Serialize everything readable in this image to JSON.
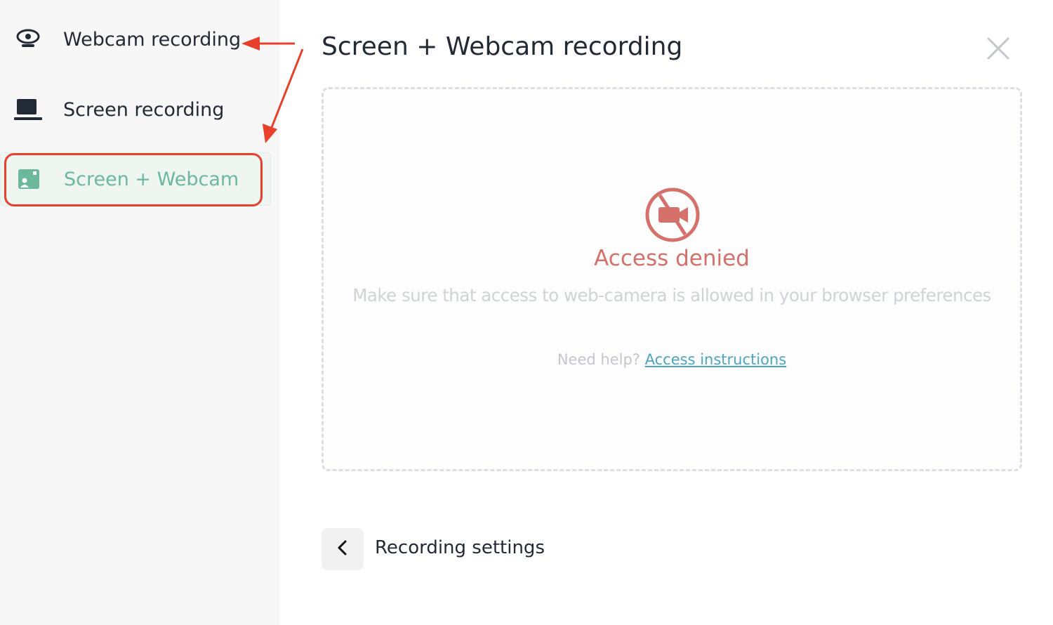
{
  "sidebar": {
    "items": [
      {
        "label": "Webcam recording",
        "icon": "webcam-icon",
        "active": false
      },
      {
        "label": "Screen recording",
        "icon": "laptop-icon",
        "active": false
      },
      {
        "label": "Screen + Webcam",
        "icon": "screen-webcam-icon",
        "active": true
      }
    ]
  },
  "main": {
    "title": "Screen + Webcam recording",
    "close_icon": "close-icon",
    "status": {
      "icon": "camera-off-icon",
      "title": "Access denied",
      "message": "Make sure that access to web-camera is allowed in your browser preferences",
      "help_prefix": "Need help?",
      "help_link": "Access instructions"
    },
    "footer": {
      "back_icon": "chevron-left-icon",
      "label": "Recording settings"
    }
  },
  "annotations": {
    "arrow_color": "#e8402b",
    "highlight_color": "#e8402b"
  },
  "colors": {
    "accent_green": "#6bb99a",
    "denied_red": "#d6706a",
    "link_blue": "#4aa6c4"
  }
}
